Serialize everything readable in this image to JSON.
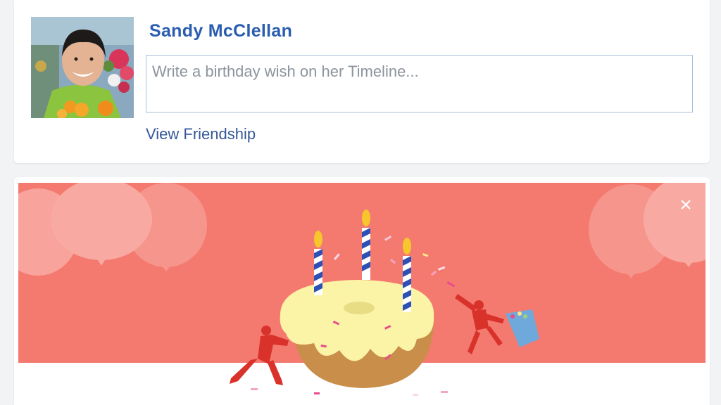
{
  "profile": {
    "name": "Sandy McClellan",
    "wish_placeholder": "Write a birthday wish on her Timeline...",
    "view_friendship": "View Friendship"
  },
  "banner": {
    "close_icon": "×",
    "colors": {
      "background": "#f47a70",
      "balloon": "#f8aaa2",
      "floor": "#ffffff",
      "cake_icing": "#fbf3a6",
      "cake_base": "#c98f4a",
      "candle_stripe": "#2d50b5",
      "flame": "#f7c52c",
      "figure": "#d9322b",
      "bucket": "#6fa9dc"
    }
  },
  "colors": {
    "name": "#2a5db0",
    "link": "#365899",
    "input_border": "#a9c1d9",
    "page_bg": "#f2f3f5"
  }
}
